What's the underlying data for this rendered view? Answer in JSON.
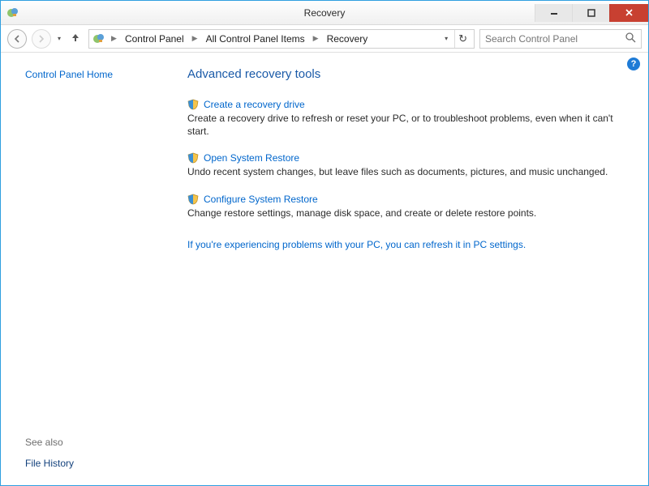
{
  "window": {
    "title": "Recovery"
  },
  "breadcrumb": {
    "items": [
      "Control Panel",
      "All Control Panel Items",
      "Recovery"
    ]
  },
  "search": {
    "placeholder": "Search Control Panel"
  },
  "sidebar": {
    "home": "Control Panel Home",
    "see_also_label": "See also",
    "see_also_link": "File History"
  },
  "main": {
    "heading": "Advanced recovery tools",
    "tools": [
      {
        "title": "Create a recovery drive",
        "desc": "Create a recovery drive to refresh or reset your PC, or to troubleshoot problems, even when it can't start."
      },
      {
        "title": "Open System Restore",
        "desc": "Undo recent system changes, but leave files such as documents, pictures, and music unchanged."
      },
      {
        "title": "Configure System Restore",
        "desc": "Change restore settings, manage disk space, and create or delete restore points."
      }
    ],
    "footer_link": "If you're experiencing problems with your PC, you can refresh it in PC settings."
  },
  "help_tip": "?"
}
